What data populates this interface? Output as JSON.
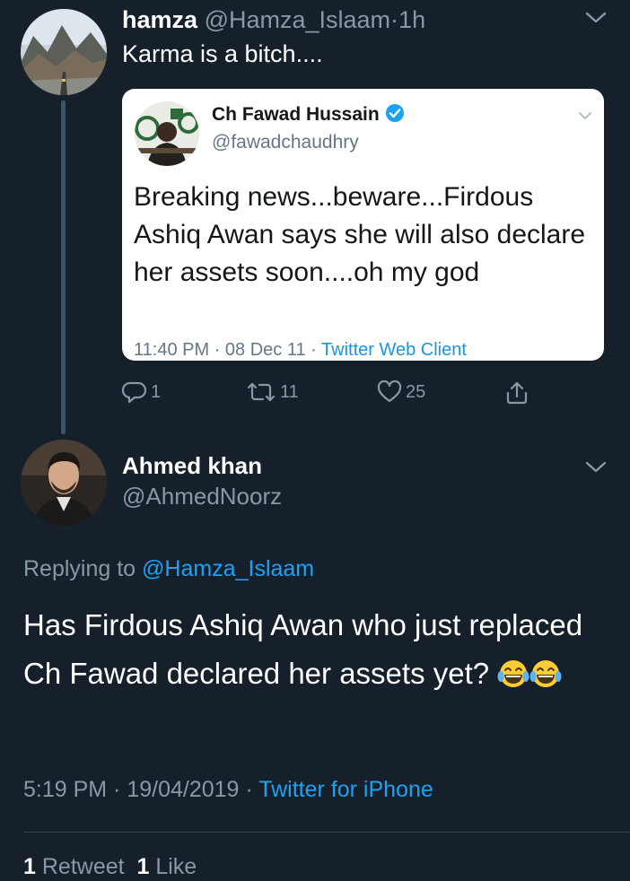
{
  "tweet1": {
    "name": "hamza",
    "handle": "@Hamza_Islaam",
    "separator": "·",
    "time": "1h",
    "text": "Karma is a bitch....",
    "quoted": {
      "name": "Ch Fawad Hussain",
      "handle": "@fawadchaudhry",
      "text": "Breaking news...beware...Firdous Ashiq Awan says she will also declare her assets soon....oh my god",
      "time": "11:40 PM",
      "date": "08 Dec 11",
      "client": "Twitter Web Client",
      "sep": " · "
    },
    "actions": {
      "replies": "1",
      "retweets": "11",
      "likes": "25"
    }
  },
  "tweet2": {
    "name": "Ahmed khan",
    "handle": "@AhmedNoorz",
    "replying_prefix": "Replying to ",
    "replying_to": "@Hamza_Islaam",
    "text": "Has Firdous Ashiq Awan who just replaced Ch Fawad declared her assets yet?",
    "time": "5:19 PM",
    "date": "19/04/2019",
    "client": "Twitter for iPhone",
    "sep": " · ",
    "retweet_count": "1",
    "retweet_label": "Retweet",
    "like_count": "1",
    "like_label": "Like"
  },
  "colors": {
    "background": "#15202b",
    "secondary_text": "#8899a6",
    "link": "#1da1f2",
    "verified": "#1da1f2"
  },
  "icons": [
    "chevron-down-icon",
    "reply-icon",
    "retweet-icon",
    "like-icon",
    "share-icon",
    "verified-badge-icon",
    "face-with-tears-of-joy-emoji"
  ]
}
